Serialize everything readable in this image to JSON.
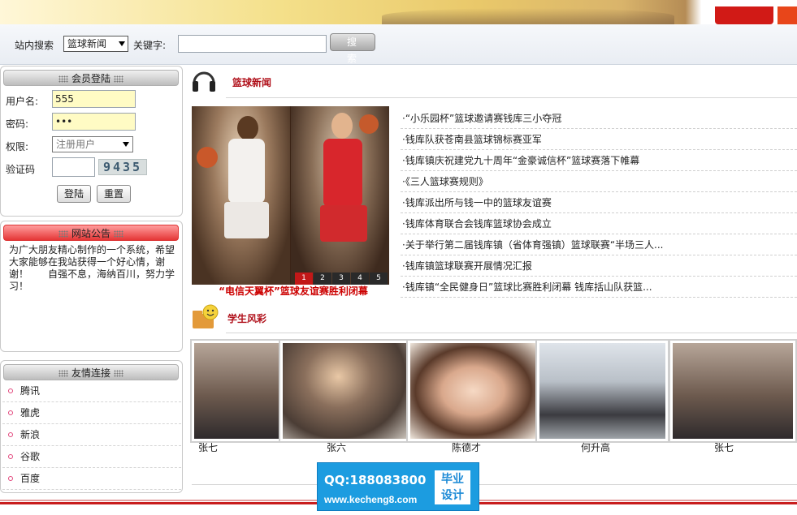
{
  "search": {
    "label": "站内搜索",
    "scope_value": "篮球新闻",
    "keyword_label": "关键字:",
    "keyword_value": "",
    "button_label": "搜 索"
  },
  "login": {
    "title": "会员登陆",
    "username_label": "用户名:",
    "username_value": "555",
    "password_label": "密码:",
    "password_value": "•••",
    "role_label": "权限:",
    "role_value": "注册用户",
    "captcha_label": "验证码",
    "captcha_text": "9435",
    "login_button": "登陆",
    "reset_button": "重置"
  },
  "notice": {
    "title": "网站公告",
    "text": "为广大朋友精心制作的一个系统，希望大家能够在我站获得一个好心情，谢谢！　　自强不息，海纳百川，努力学习！"
  },
  "links": {
    "title": "友情连接",
    "items": [
      "腾讯",
      "雅虎",
      "新浪",
      "谷歌",
      "百度"
    ]
  },
  "news": {
    "title": "篮球新闻",
    "caption": "“电信天翼杯”篮球友谊赛胜利闭幕",
    "slides": [
      "1",
      "2",
      "3",
      "4",
      "5"
    ],
    "items": [
      "·“小乐园杯”篮球邀请赛钱库三小夺冠",
      "·钱库队获苍南县篮球锦标赛亚军",
      "·钱库镇庆祝建党九十周年“金豪诚信杯”篮球赛落下帷幕",
      "·《三人篮球赛规则》",
      "·钱库派出所与钱一中的篮球友谊赛",
      "·钱库体育联合会钱库篮球协会成立",
      "·关于举行第二届钱库镇（省体育强镇）篮球联赛“半场三人...",
      "·钱库镇篮球联赛开展情况汇报",
      "·钱库镇“全民健身日”篮球比赛胜利闭幕 钱库括山队获篮..."
    ]
  },
  "students": {
    "title": "学生风彩",
    "items": [
      {
        "name": "张七"
      },
      {
        "name": "张六"
      },
      {
        "name": "陈德才"
      },
      {
        "name": "何升高"
      },
      {
        "name": "张七"
      }
    ]
  },
  "watermark": {
    "qq": "QQ:188083800",
    "url": "www.kecheng8.com",
    "box_line1": "毕业",
    "box_line2": "设计"
  }
}
